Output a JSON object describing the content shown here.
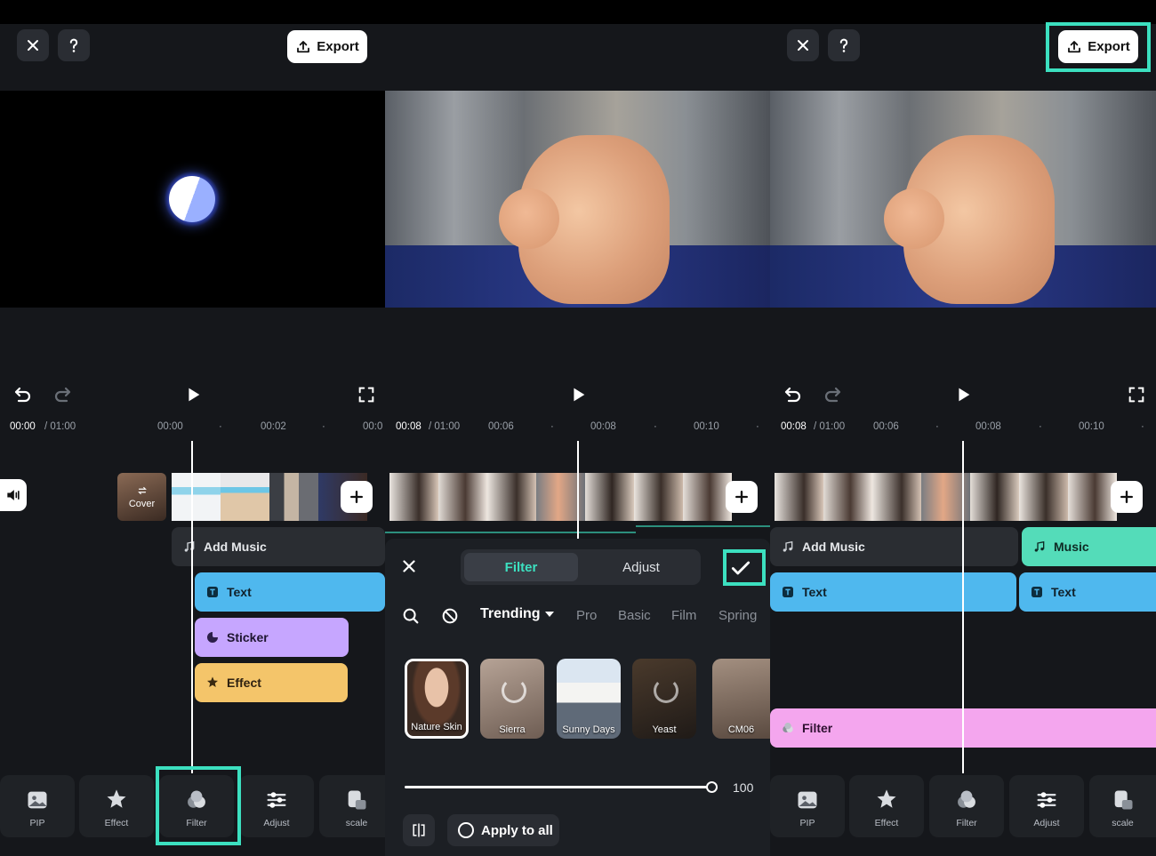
{
  "panels": {
    "left": {
      "export_label": "Export",
      "cover_label": "Cover",
      "ruler": {
        "current": "00:00",
        "total": "/ 01:00",
        "ticks": [
          "00:00",
          "00:02",
          "00:0"
        ]
      },
      "tracks": {
        "add_music": "Add Music",
        "text": "Text",
        "sticker": "Sticker",
        "effect": "Effect"
      },
      "tools": [
        "PIP",
        "Effect",
        "Filter",
        "Adjust",
        "scale"
      ]
    },
    "middle": {
      "ruler": {
        "current": "00:08",
        "total": "/ 01:00",
        "ticks": [
          "00:06",
          "00:08",
          "00:10"
        ]
      },
      "tabs": {
        "filter": "Filter",
        "adjust": "Adjust"
      },
      "categories": {
        "trending": "Trending",
        "pro": "Pro",
        "basic": "Basic",
        "film": "Film",
        "spring": "Spring"
      },
      "filters": [
        "Nature Skin",
        "Sierra",
        "Sunny Days",
        "Yeast",
        "CM06"
      ],
      "intensity": "100",
      "apply_all": "Apply to all"
    },
    "right": {
      "export_label": "Export",
      "ruler": {
        "current": "00:08",
        "total": "/ 01:00",
        "ticks": [
          "00:06",
          "00:08",
          "00:10"
        ]
      },
      "tracks": {
        "add_music": "Add Music",
        "music": "Music",
        "text1": "Text",
        "text2": "Text",
        "filter": "Filter"
      },
      "tools": [
        "PIP",
        "Effect",
        "Filter",
        "Adjust",
        "scale"
      ]
    }
  },
  "colors": {
    "accent": "#3ce0c0",
    "text_track": "#4fb8ee",
    "sticker_track": "#c6a6ff",
    "effect_track": "#f4c56a",
    "music_track": "#54dcb9",
    "filter_track": "#f4a6ee"
  }
}
